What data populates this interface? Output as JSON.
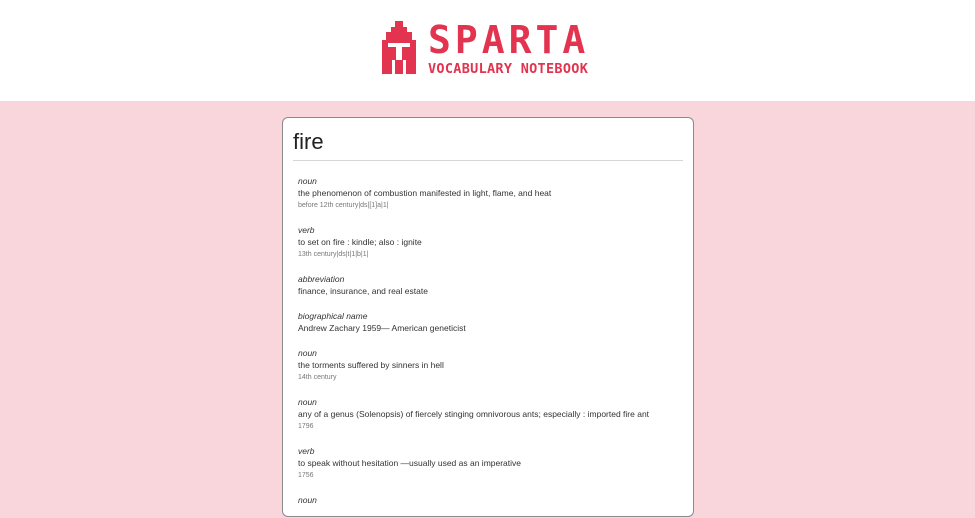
{
  "header": {
    "title": "SPARTA",
    "subtitle": "VOCABULARY NOTEBOOK",
    "brand_color": "#e2334f",
    "logo_icon": "spartan-helmet-icon"
  },
  "card": {
    "word": "fire",
    "definitions": [
      {
        "pos": "noun",
        "meaning": "the phenomenon of combustion manifested in light, flame, and heat",
        "date": "before 12th century|ds|[1]a|1|"
      },
      {
        "pos": "verb",
        "meaning": "to set on fire : kindle; also : ignite",
        "date": "13th century|ds|t|1|b|1|"
      },
      {
        "pos": "abbreviation",
        "meaning": "finance, insurance, and real estate",
        "date": ""
      },
      {
        "pos": "biographical name",
        "meaning": "Andrew Zachary 1959— American geneticist",
        "date": ""
      },
      {
        "pos": "noun",
        "meaning": "the torments suffered by sinners in hell",
        "date": "14th century"
      },
      {
        "pos": "noun",
        "meaning": "any of a genus (Solenopsis) of fiercely stinging omnivorous ants; especially : imported fire ant",
        "date": "1796"
      },
      {
        "pos": "verb",
        "meaning": "to speak without hesitation —usually used as an imperative",
        "date": "1756"
      },
      {
        "pos": "noun",
        "meaning": "",
        "date": ""
      }
    ]
  }
}
